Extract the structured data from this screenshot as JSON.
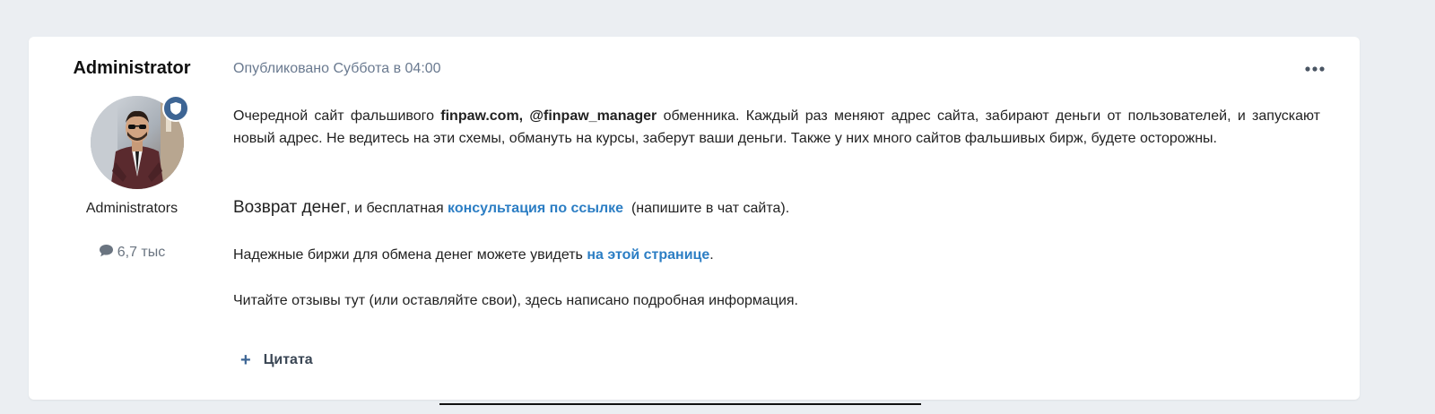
{
  "author": {
    "name": "Administrator",
    "group": "Administrators",
    "post_count": "6,7 тыс",
    "avatar_icon": "user-photo",
    "badge_icon": "shield-icon",
    "count_icon": "speech-bubble-icon"
  },
  "post": {
    "meta": "Опубликовано Суббота в 04:00",
    "more_icon": "ellipsis-icon",
    "p1": {
      "before": "Очередной сайт фальшивого ",
      "bold": "finpaw.com, @finpaw_manager",
      "after": " обменника. Каждый раз меняют адрес сайта, забирают деньги от пользователей, и запускают новый адрес. Не ведитесь на эти схемы, обмануть на курсы, заберут ваши деньги. Также у них много сайтов фальшивых бирж, будете осторожны."
    },
    "p2": {
      "big": "Возврат денег",
      "mid": ", и бесплатная ",
      "link": "консультация по ссылке",
      "after": "  (напишите в чат сайта)."
    },
    "p3": {
      "before": "Надежные биржи для обмена денег можете увидеть ",
      "link": "на этой странице",
      "after": "."
    },
    "p4": "Читайте отзывы тут (или оставляйте свои), здесь написано подробная информация.",
    "quote_label": "Цитата",
    "quote_icon": "plus-icon"
  },
  "colors": {
    "background": "#ebeef2",
    "card": "#ffffff",
    "link": "#2c7ec4",
    "meta": "#6a7a90",
    "badge": "#3d6594"
  }
}
